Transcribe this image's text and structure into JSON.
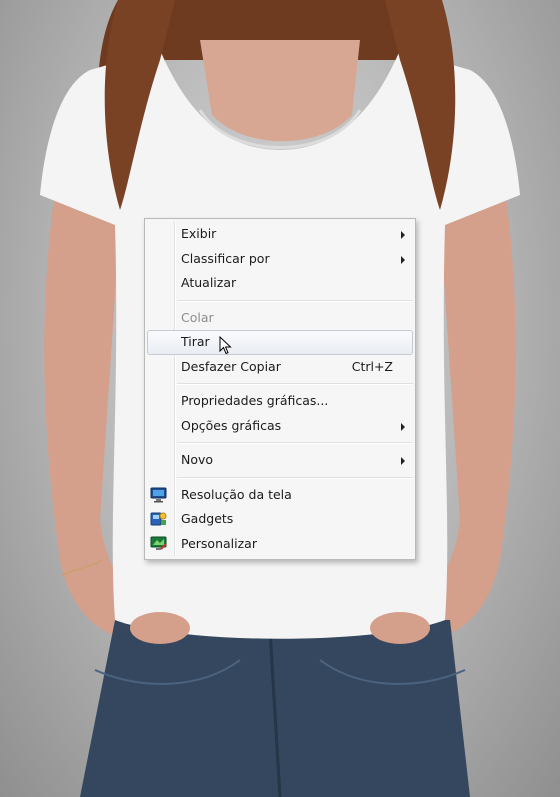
{
  "colors": {
    "shirt": "#f4f4f4",
    "hair": "#6e3a20",
    "jeans": "#34475e",
    "skin": "#d7a793",
    "menu_bg": "#f6f6f6",
    "hover_border": "#c6cad2"
  },
  "menu": {
    "exibir": "Exibir",
    "classificar": "Classificar por",
    "atualizar": "Atualizar",
    "colar": "Colar",
    "tirar": "Tirar",
    "desfazer": "Desfazer Copiar",
    "desfazer_shortcut": "Ctrl+Z",
    "propriedades": "Propriedades gráficas...",
    "opcoes": "Opções gráficas",
    "novo": "Novo",
    "resolucao": "Resolução da tela",
    "gadgets": "Gadgets",
    "personalizar": "Personalizar"
  },
  "icons": {
    "resolucao": "monitor-icon",
    "gadgets": "gadgets-icon",
    "personalizar": "personalize-icon",
    "cursor": "mouse-pointer-icon"
  }
}
